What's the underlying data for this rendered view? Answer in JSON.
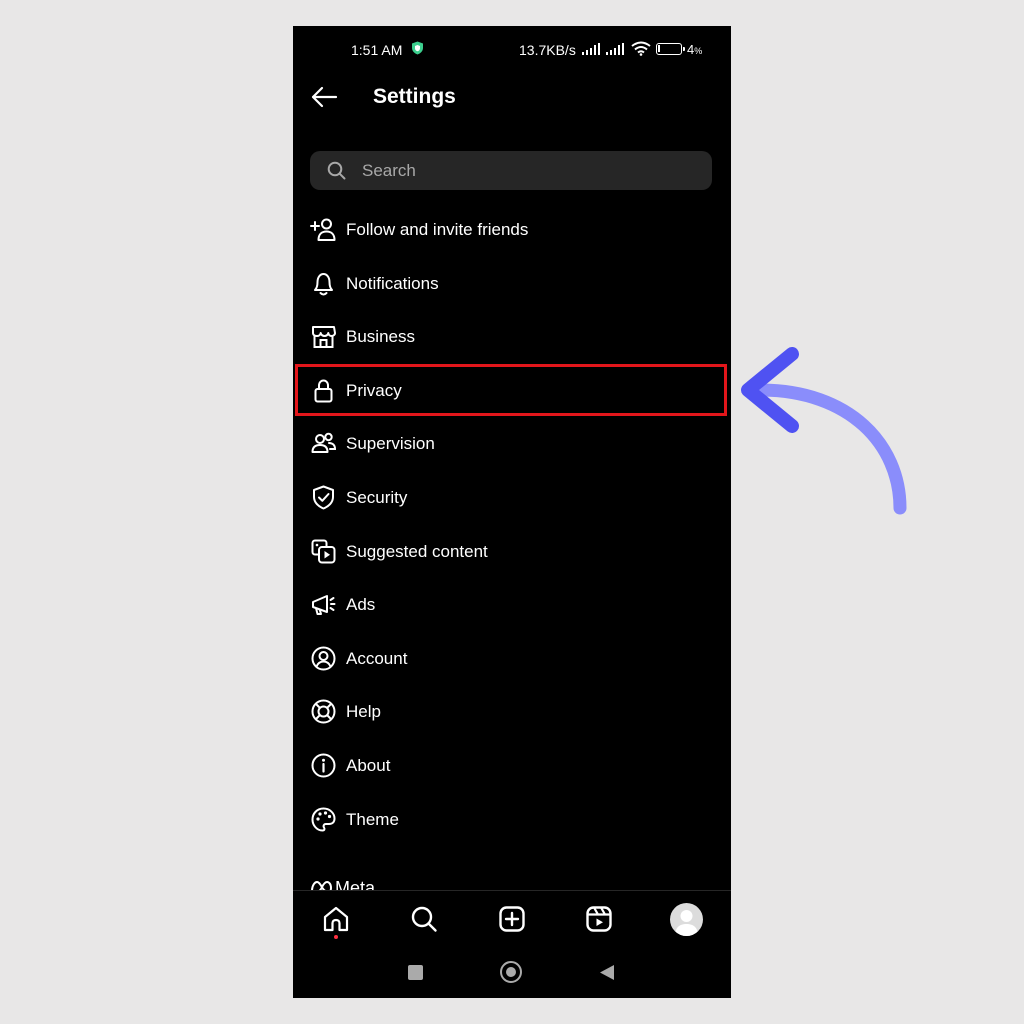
{
  "status_bar": {
    "time": "1:51 AM",
    "speed": "13.7KB/s",
    "battery_pct": "4",
    "battery_suffix": "%"
  },
  "header": {
    "title": "Settings"
  },
  "search": {
    "placeholder": "Search"
  },
  "menu": {
    "items": [
      {
        "label": "Follow and invite friends",
        "icon": "add-person-icon"
      },
      {
        "label": "Notifications",
        "icon": "bell-icon"
      },
      {
        "label": "Business",
        "icon": "storefront-icon"
      },
      {
        "label": "Privacy",
        "icon": "lock-icon"
      },
      {
        "label": "Supervision",
        "icon": "people-icon"
      },
      {
        "label": "Security",
        "icon": "shield-check-icon"
      },
      {
        "label": "Suggested content",
        "icon": "media-play-icon"
      },
      {
        "label": "Ads",
        "icon": "megaphone-icon"
      },
      {
        "label": "Account",
        "icon": "user-circle-icon"
      },
      {
        "label": "Help",
        "icon": "lifebuoy-icon"
      },
      {
        "label": "About",
        "icon": "info-icon"
      },
      {
        "label": "Theme",
        "icon": "palette-icon"
      }
    ],
    "highlighted": "Privacy"
  },
  "footer": {
    "brand": "Meta"
  },
  "colors": {
    "background": "#000000",
    "highlight": "#e3161b",
    "arrow": "#5b5ff5",
    "page": "#e8e7e7"
  }
}
